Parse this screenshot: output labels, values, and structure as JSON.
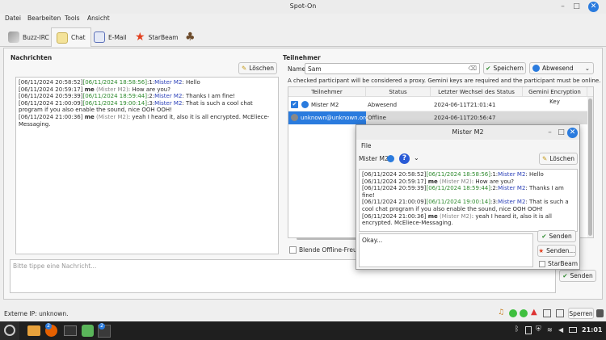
{
  "window": {
    "title": "Spot-On"
  },
  "menu": [
    "Datei",
    "Bearbeiten",
    "Tools",
    "Ansicht"
  ],
  "tabs": [
    {
      "label": "Buzz-IRC"
    },
    {
      "label": "Chat"
    },
    {
      "label": "E-Mail"
    },
    {
      "label": "StarBeam"
    }
  ],
  "messages_panel": {
    "title": "Nachrichten",
    "clear_button": "Löschen",
    "lines": [
      {
        "ts": "[06/11/2024 20:58:52]",
        "tsr": "[06/11/2024 18:58:56]",
        "seq": ":1:",
        "name": "Mister M2",
        "text": ": Hello"
      },
      {
        "ts": "[06/11/2024 20:59:17]",
        "me": "me",
        "alias": "(Mister M2)",
        "text": ": How are you?"
      },
      {
        "ts": "[06/11/2024 20:59:39]",
        "tsr": "[06/11/2024 18:59:44]",
        "seq": ":2:",
        "name": "Mister M2",
        "text": ": Thanks I am fine!"
      },
      {
        "ts": "[06/11/2024 21:00:09]",
        "tsr": "[06/11/2024 19:00:14]",
        "seq": ":3:",
        "name": "Mister M2",
        "text": ": That is such a cool chat program if you also enable the sound, nice OOH OOH!"
      },
      {
        "ts": "[06/11/2024 21:00:36]",
        "me": "me",
        "alias": "(Mister M2)",
        "text": ": yeah I heard it, also it is all encrypted. McEliece-Messaging."
      }
    ]
  },
  "participants_panel": {
    "title": "Teilnehmer",
    "name_label": "Name",
    "name_value": "Sam",
    "save_button": "Speichern",
    "status_select": "Abwesend",
    "hint": "A checked participant will be considered a proxy. Gemini keys are required and the participant must be online.",
    "columns": [
      "Teilnehmer",
      "Status",
      "Letzter Wechsel des Status",
      "Gemini Encryption Key"
    ],
    "rows": [
      {
        "name": "Mister M2",
        "status": "Abwesend",
        "changed": "2024-06-11T21:01:41",
        "key": ""
      },
      {
        "name": "unknown@unknown.org",
        "status": "Offline",
        "changed": "2024-06-11T20:56:47",
        "key": ""
      }
    ],
    "blend_offline": "Blende Offline-Freunde"
  },
  "compose": {
    "placeholder": "Bitte tippe eine Nachricht...",
    "send_button": "Senden"
  },
  "status_bar": {
    "external_ip": "Externe IP: unknown.",
    "lock_button": "Sperren"
  },
  "popup": {
    "title": "Mister M2",
    "menu_file": "File",
    "participant": "Mister M2",
    "clear_button": "Löschen",
    "lines": [
      {
        "ts": "[06/11/2024 20:58:52]",
        "tsr": "[06/11/2024 18:58:56]",
        "seq": ":1:",
        "name": "Mister M2",
        "text": ": Hello"
      },
      {
        "ts": "[06/11/2024 20:59:17]",
        "me": "me",
        "alias": "(Mister M2)",
        "text": ": How are you?"
      },
      {
        "ts": "[06/11/2024 20:59:39]",
        "tsr": "[06/11/2024 18:59:44]",
        "seq": ":2:",
        "name": "Mister M2",
        "text": ": Thanks I am fine!"
      },
      {
        "ts": "[06/11/2024 21:00:09]",
        "tsr": "[06/11/2024 19:00:14]",
        "seq": ":3:",
        "name": "Mister M2",
        "text": ": That is such a cool chat program if you also enable the sound, nice OOH OOH!"
      },
      {
        "ts": "[06/11/2024 21:00:36]",
        "me": "me",
        "alias": "(Mister M2)",
        "text": ": yeah I heard it, also it is all encrypted. McEliece-Messaging."
      }
    ],
    "compose_value": "Okay...",
    "send_button": "Senden",
    "send_file_button": "Senden...",
    "starbeam_label": "StarBeam"
  },
  "taskbar": {
    "badge1": "2",
    "badge2": "2",
    "clock": "21:01"
  },
  "colors": {
    "accent": "#2a7bde",
    "timestamp_green": "#2d8a2d",
    "name_blue": "#2a3fb8",
    "selected_row": "#cfe2f7",
    "taskbar": "#1f1f1f"
  }
}
